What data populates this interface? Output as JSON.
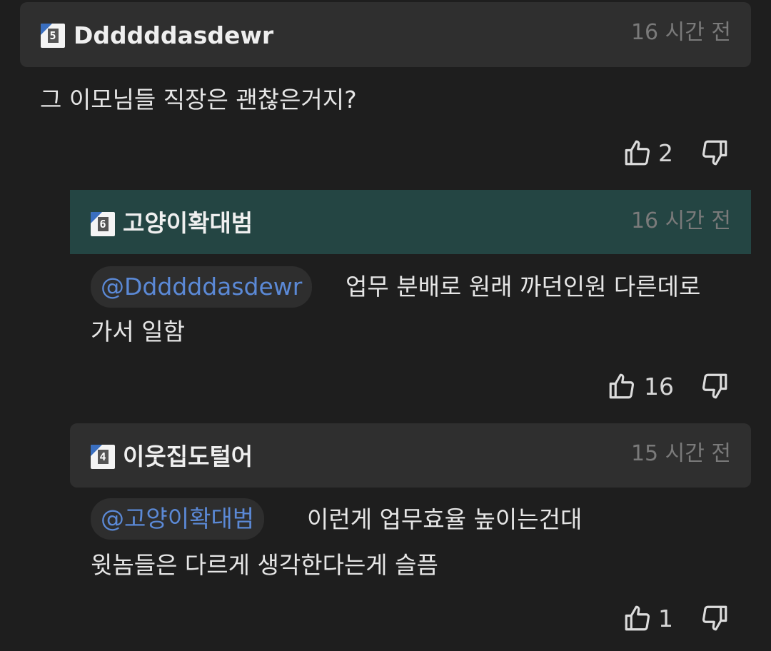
{
  "comments": [
    {
      "level": "5",
      "username": "Ddddddasdewr",
      "time": "16 시간 전",
      "mention": "",
      "line1": "그 이모님들 직장은 괜찮은거지?",
      "line2": "",
      "likes": "2"
    },
    {
      "level": "6",
      "username": "고양이확대범",
      "time": "16 시간 전",
      "mention": "@Ddddddasdewr",
      "line1": "업무 분배로 원래 까던인원 다른데로",
      "line2": "가서 일함",
      "likes": "16"
    },
    {
      "level": "4",
      "username": "이웃집도털어",
      "time": "15 시간 전",
      "mention": "@고양이확대범",
      "line1": "이런게 업무효율 높이는건대",
      "line2": "윗놈들은 다르게 생각한다는게 슬픔",
      "likes": "1"
    }
  ],
  "icons": {
    "like": "thumbs-up-icon",
    "dislike": "thumbs-down-icon"
  },
  "colors": {
    "background": "#1e1e1e",
    "header": "#2f2f2f",
    "header_highlight": "#244543",
    "mention": "#5b89d6",
    "timestamp": "#7a7a7a"
  }
}
